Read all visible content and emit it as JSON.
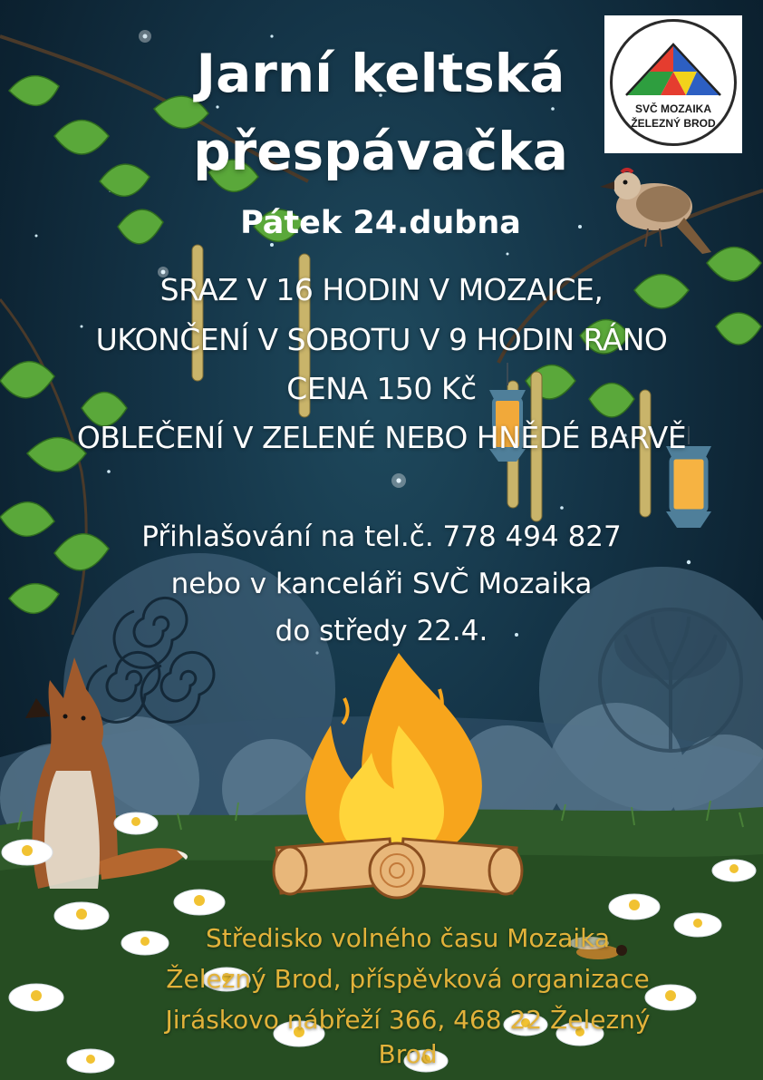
{
  "poster": {
    "title_line1": "Jarní keltská",
    "title_line2": "přespávačka",
    "date": "Pátek  24.dubna",
    "info": [
      "SRAZ V 16 HODIN V MOZAICE,",
      "UKONČENÍ V SOBOTU V 9 HODIN RÁNO",
      "CENA 150 Kč",
      "OBLEČENÍ V ZELENÉ NEBO HNĚDÉ BARVĚ"
    ],
    "registration": [
      "Přihlašování na tel.č. 778 494 827",
      "nebo v kanceláři SVČ Mozaika",
      "do středy 22.4."
    ],
    "footer": [
      "Středisko volného času Mozaika",
      "Železný Brod, příspěvková organizace",
      "Jiráskovo nábřeží 366, 468 22 Železný",
      "Brod"
    ]
  },
  "logo": {
    "line1": "SVČ MOZAIKA",
    "line2": "ŽELEZNÝ BROD",
    "colors": [
      "#2e9e3f",
      "#e53d2f",
      "#f2d21b",
      "#2d5fc2"
    ]
  },
  "illustrations": {
    "icons": [
      "leaf-branch-icon",
      "bird-icon",
      "lantern-icon",
      "fox-icon",
      "campfire-icon",
      "celtic-spiral-icon",
      "tree-of-life-icon",
      "daisy-flower-icon",
      "insect-icon"
    ]
  },
  "colors": {
    "background": "#143447",
    "title_text": "#ffffff",
    "footer_text": "#e2b23a",
    "grass": "#2f5a2a",
    "flame": "#f7a51c"
  }
}
